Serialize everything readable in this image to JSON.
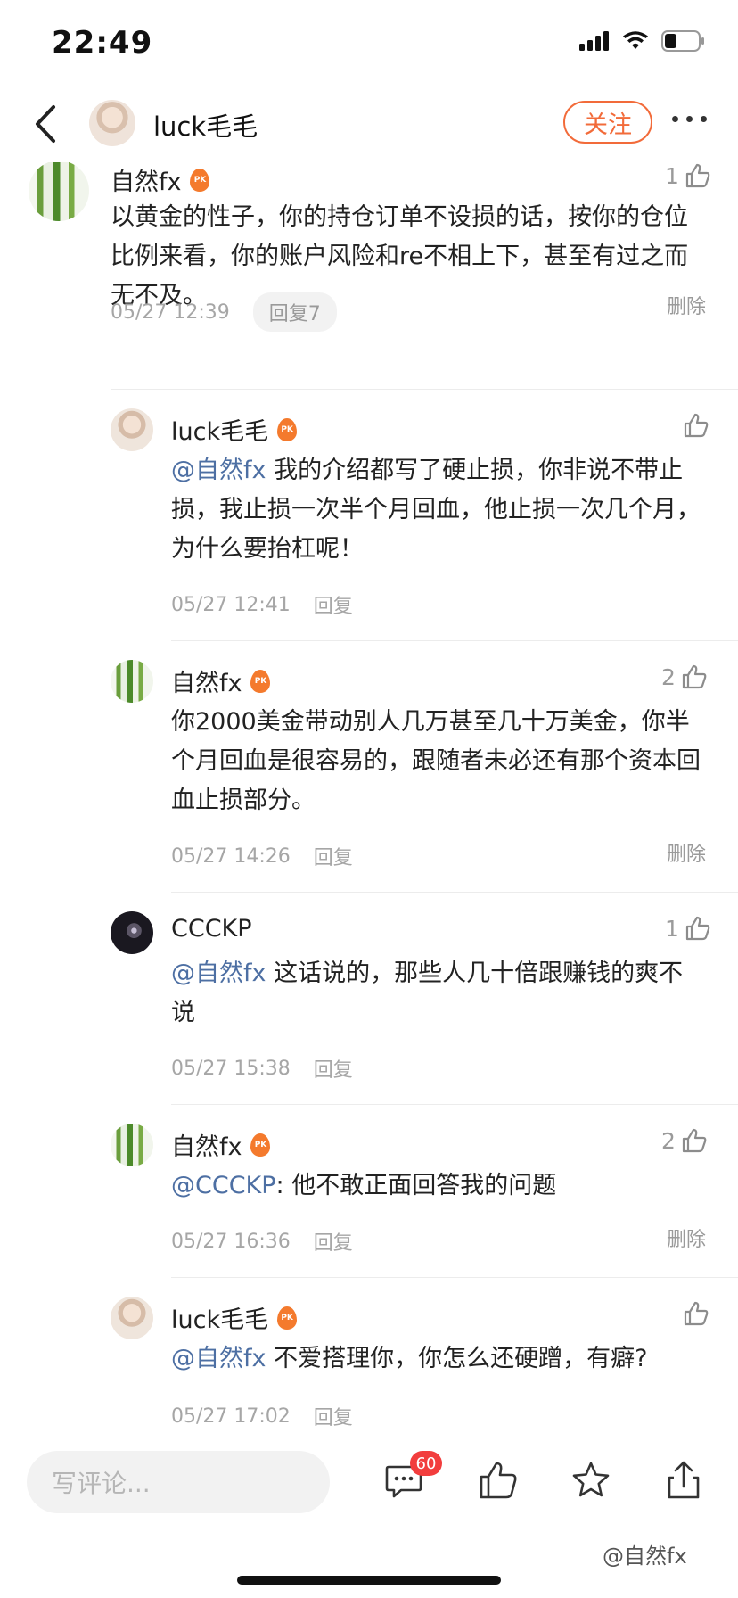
{
  "status_bar": {
    "time": "22:49"
  },
  "header": {
    "title": "luck毛毛",
    "follow_label": "关注"
  },
  "comments": [
    {
      "name": "自然fx",
      "mention": "",
      "text": "以黄金的性子，你的持仓订单不设损的话，按你的仓位比例来看，你的账户风险和re不相上下，甚至有过之而无不及。",
      "time": "05/27 12:39",
      "reply": "回复7",
      "delete": "删除",
      "likes": "1"
    },
    {
      "name": "luck毛毛",
      "mention": "@自然fx",
      "text": " 我的介绍都写了硬止损，你非说不带止损，我止损一次半个月回血，他止损一次几个月，为什么要抬杠呢！",
      "time": "05/27 12:41",
      "reply": "回复",
      "delete": "",
      "likes": ""
    },
    {
      "name": "自然fx",
      "mention": "",
      "text": "你2000美金带动别人几万甚至几十万美金，你半个月回血是很容易的，跟随者未必还有那个资本回血止损部分。",
      "time": "05/27 14:26",
      "reply": "回复",
      "delete": "删除",
      "likes": "2"
    },
    {
      "name": "CCCKP",
      "mention": "@自然fx",
      "text": " 这话说的，那些人几十倍跟赚钱的爽不说",
      "time": "05/27 15:38",
      "reply": "回复",
      "delete": "",
      "likes": "1"
    },
    {
      "name": "自然fx",
      "mention": "@CCCKP",
      "text": ": 他不敢正面回答我的问题",
      "time": "05/27 16:36",
      "reply": "回复",
      "delete": "删除",
      "likes": "2"
    },
    {
      "name": "luck毛毛",
      "mention": "@自然fx",
      "text": " 不爱搭理你，你怎么还硬蹭，有癖?",
      "time": "05/27 17:02",
      "reply": "回复",
      "delete": "",
      "likes": ""
    }
  ],
  "badge_label": "PK",
  "bottom_bar": {
    "placeholder": "写评论...",
    "comment_count": "60",
    "watermark": "@自然fx"
  }
}
